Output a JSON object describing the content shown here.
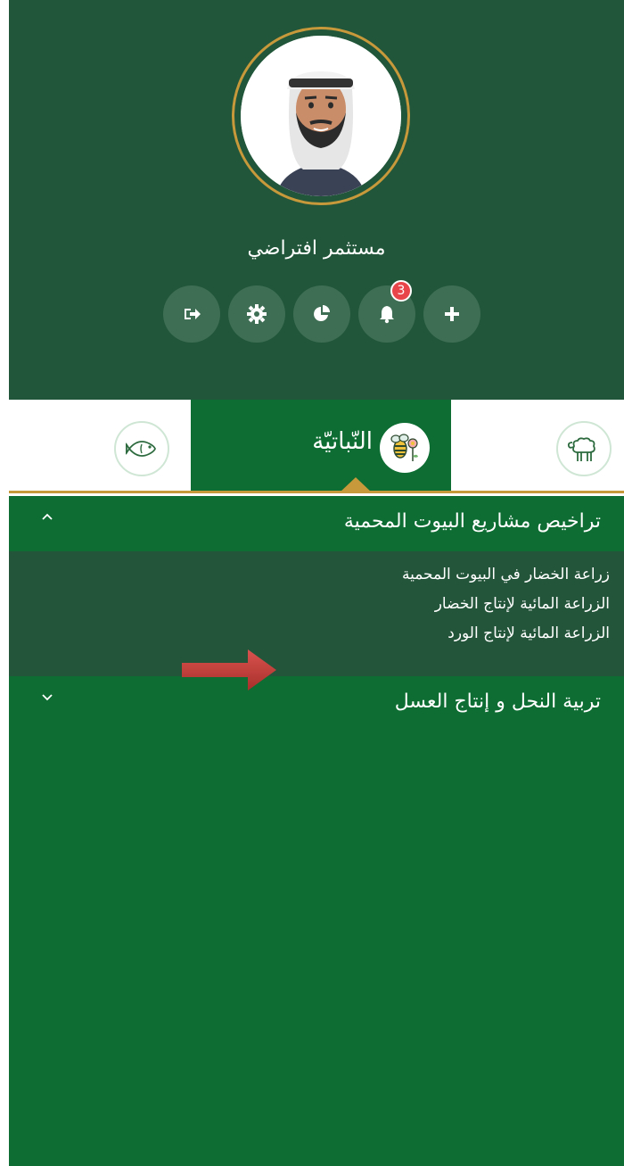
{
  "profile": {
    "username": "مستثمر افتراضي",
    "notifications_count": "3",
    "actions": [
      "logout-icon",
      "gear-icon",
      "pie-chart-icon",
      "bell-icon",
      "plus-icon"
    ]
  },
  "tabs": {
    "fish": {
      "icon": "fish-icon"
    },
    "plant": {
      "label": "النّباتيّة",
      "icon": "bee-flower-icon"
    },
    "sheep": {
      "icon": "sheep-icon"
    }
  },
  "accordion": {
    "section1": {
      "title": "تراخيص مشاريع البيوت المحمية",
      "items": [
        {
          "label": "زراعة الخضار في البيوت المحمية"
        },
        {
          "label": "الزراعة المائية لإنتاج الخضار"
        },
        {
          "label": "الزراعة المائية لإنتاج الورد"
        }
      ]
    },
    "section2": {
      "title": "تربية النحل و إنتاج العسل"
    }
  },
  "colors": {
    "profile_bg": "#21563a",
    "tab_active": "#0d6d33",
    "accent_gold": "#c8993a",
    "submenu_bg": "#23553a",
    "badge": "#e8454a",
    "arrow": "#c0392b"
  }
}
